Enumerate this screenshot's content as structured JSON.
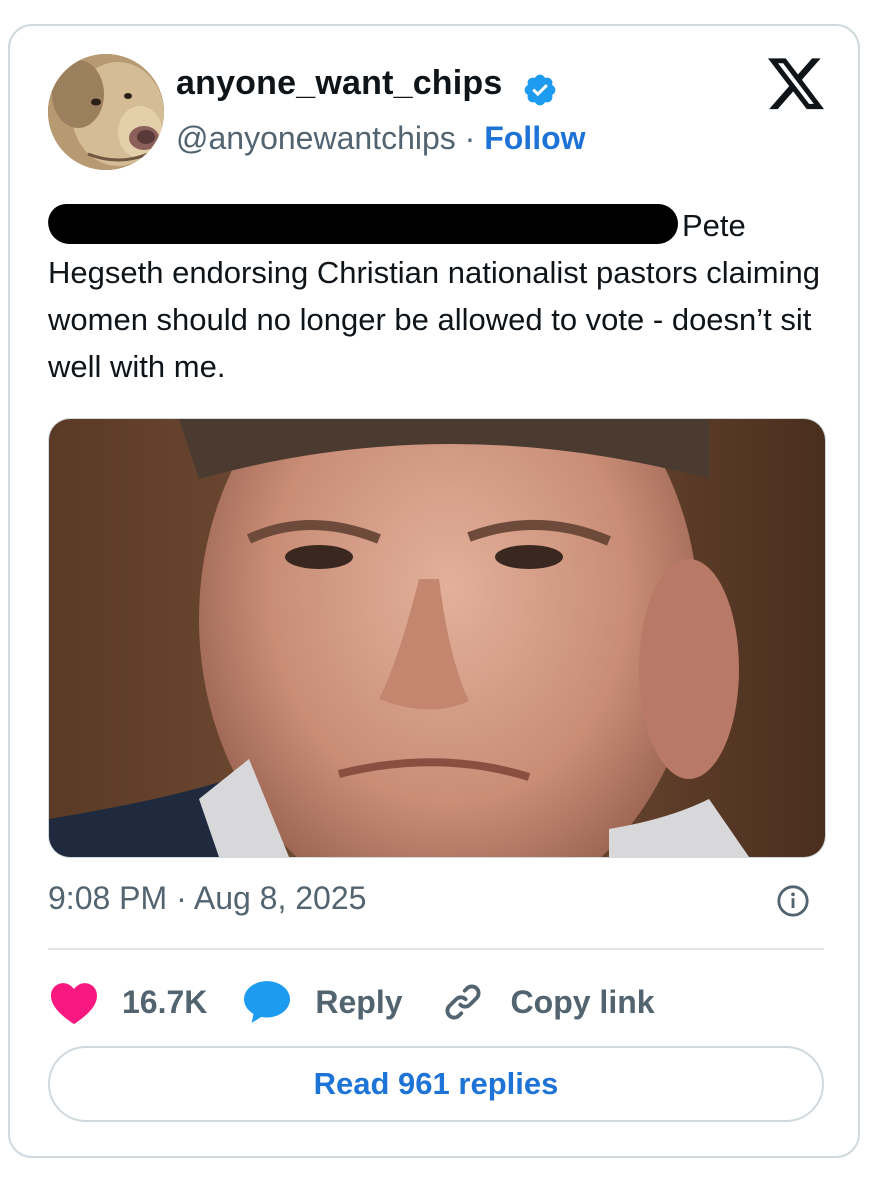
{
  "author": {
    "display_name": "anyone_want_chips",
    "handle": "@anyonewantchips",
    "separator": "·",
    "follow_label": "Follow"
  },
  "tweet": {
    "text_after_redaction": "Pete Hegseth endorsing Christian nationalist pastors claiming women should no longer be allowed to vote - doesn’t sit well with me.",
    "timestamp": "9:08 PM · Aug 8, 2025"
  },
  "actions": {
    "likes_count": "16.7K",
    "reply_label": "Reply",
    "copy_link_label": "Copy link"
  },
  "read_replies_label": "Read 961 replies",
  "icons": {
    "avatar": "dog-avatar",
    "verified": "verified-badge-icon",
    "platform": "x-logo-icon",
    "info": "info-icon",
    "like": "heart-icon",
    "reply": "speech-bubble-icon",
    "copy": "link-icon"
  },
  "colors": {
    "link_blue": "#1d73d6",
    "heart_pink": "#f91880",
    "reply_blue": "#1d9bf0",
    "muted_text": "#536471",
    "border": "#cfd9de"
  }
}
